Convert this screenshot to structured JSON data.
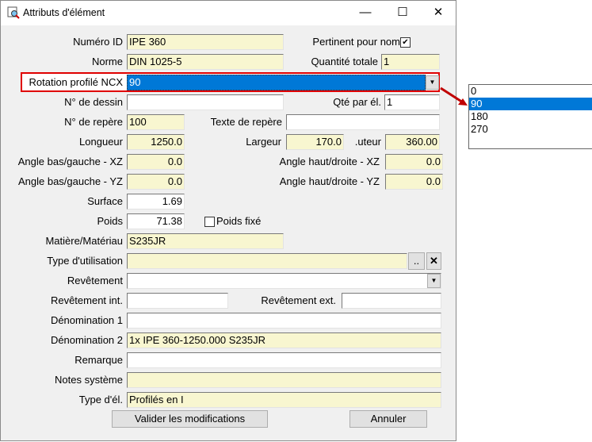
{
  "window": {
    "title": "Attributs d'élément",
    "minimize": "—",
    "maximize": "☐",
    "close": "✕"
  },
  "fields": {
    "numero_id": {
      "label": "Numéro ID",
      "value": "IPE 360"
    },
    "pertinent": {
      "label": "Pertinent pour nom",
      "checked": true,
      "mark": "✔"
    },
    "norme": {
      "label": "Norme",
      "value": "DIN 1025-5"
    },
    "quantite_totale": {
      "label": "Quantité totale",
      "value": "1"
    },
    "rotation": {
      "label": "Rotation profilé NCX",
      "value": "90",
      "arrow": "▼"
    },
    "no_dessin": {
      "label": "N° de dessin",
      "value": ""
    },
    "qte_par_el": {
      "label": "Qté par él.",
      "value": "1"
    },
    "no_repere": {
      "label": "N° de repère",
      "value": "100"
    },
    "texte_repere": {
      "label": "Texte de repère",
      "value": ""
    },
    "longueur": {
      "label": "Longueur",
      "value": "1250.0"
    },
    "largeur": {
      "label": "Largeur",
      "value": "170.0"
    },
    "hauteur": {
      "label": ".uteur",
      "value": "360.00"
    },
    "angle_bg_xz": {
      "label": "Angle bas/gauche - XZ",
      "value": "0.0"
    },
    "angle_hd_xz": {
      "label": "Angle haut/droite - XZ",
      "value": "0.0"
    },
    "angle_bg_yz": {
      "label": "Angle bas/gauche - YZ",
      "value": "0.0"
    },
    "angle_hd_yz": {
      "label": "Angle haut/droite - YZ",
      "value": "0.0"
    },
    "surface": {
      "label": "Surface",
      "value": "1.69"
    },
    "poids": {
      "label": "Poids",
      "value": "71.38"
    },
    "poids_fixe": {
      "label": "Poids fixé",
      "checked": false
    },
    "matiere": {
      "label": "Matière/Matériau",
      "value": "S235JR"
    },
    "type_utilisation": {
      "label": "Type d'utilisation",
      "value": "",
      "browse": "..",
      "clear": "✕"
    },
    "revetement": {
      "label": "Revêtement",
      "value": "",
      "arrow": "▼"
    },
    "revetement_int": {
      "label": "Revêtement int.",
      "value": ""
    },
    "revetement_ext": {
      "label": "Revêtement ext.",
      "value": ""
    },
    "denomination1": {
      "label": "Dénomination 1",
      "value": ""
    },
    "denomination2": {
      "label": "Dénomination 2",
      "value": "1x IPE 360-1250.000 S235JR"
    },
    "remarque": {
      "label": "Remarque",
      "value": ""
    },
    "notes_systeme": {
      "label": "Notes système",
      "value": ""
    },
    "type_el": {
      "label": "Type d'él.",
      "value": "Profilés en I"
    }
  },
  "buttons": {
    "validate": "Valider les modifications",
    "cancel": "Annuler"
  },
  "dropdown": {
    "options": [
      "0",
      "90",
      "180",
      "270"
    ],
    "selected": "90"
  },
  "colors": {
    "highlight": "#0078d7",
    "callout": "#e00000",
    "field_yellow": "#f8f6d0"
  }
}
